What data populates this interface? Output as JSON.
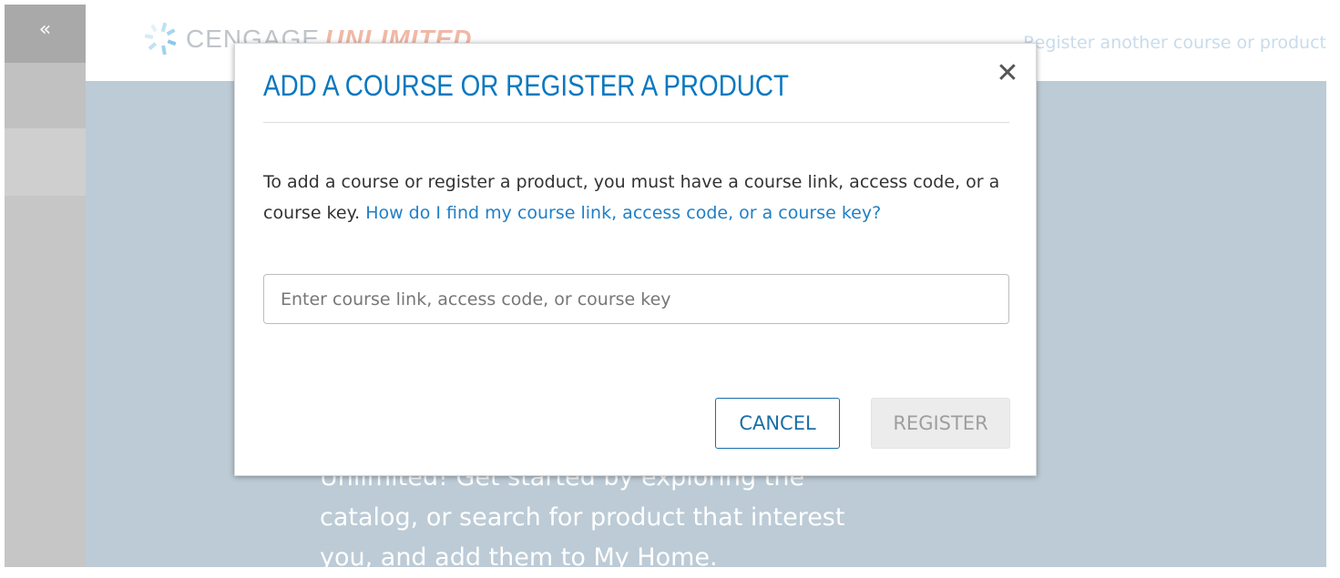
{
  "sidebar": {
    "collapse_label": "«"
  },
  "header": {
    "logo_text_1": "CENGAGE",
    "logo_text_2": "UNLIMITED",
    "register_link": "Register another course or product"
  },
  "background": {
    "body_text": "Unlimited! Get started by exploring the catalog, or search for product that interest you, and add them to My Home."
  },
  "modal": {
    "title": "ADD A COURSE OR REGISTER A PRODUCT",
    "close_label": "✕",
    "instructions": "To add a course or register a product, you must have a course link, access code, or a course key. ",
    "help_link": "How do I find my course link, access code, or a course key?",
    "input_placeholder": "Enter course link, access code, or course key",
    "input_value": "",
    "cancel_label": "CANCEL",
    "register_label": "REGISTER"
  },
  "colors": {
    "accent": "#0a78bf",
    "link": "#1f7fc6",
    "overlay_bg": "#bccbd6",
    "sidebar_bg": "#c6c6c6"
  },
  "icons": {
    "logo": "cengage-logo-icon",
    "close": "close-icon"
  }
}
